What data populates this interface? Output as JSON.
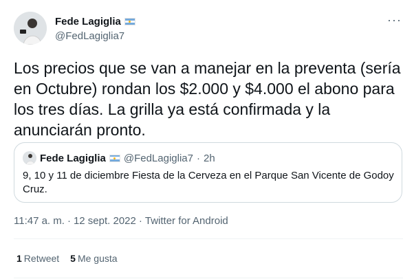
{
  "author": {
    "name": "Fede Lagiglia",
    "handle": "@FedLagiglia7"
  },
  "tweet": {
    "text": "Los precios que se van a manejar en la preventa (sería en Octubre) rondan los $2.000 y $4.000 el abono para los tres días. La grilla ya está confirmada y la anunciarán pronto."
  },
  "quoted": {
    "name": "Fede Lagiglia",
    "handle": "@FedLagiglia7",
    "separator": "·",
    "time": "2h",
    "text": "9, 10 y 11 de diciembre Fiesta de la Cerveza en el Parque San Vicente de Godoy Cruz."
  },
  "meta": {
    "time": "11:47 a. m.",
    "separator": "·",
    "date": "12 sept. 2022",
    "source": "Twitter for Android"
  },
  "stats": {
    "retweets_count": "1",
    "retweets_label": "Retweet",
    "likes_count": "5",
    "likes_label": "Me gusta"
  },
  "menu": {
    "more_label": "···"
  },
  "icons": {
    "flag": "argentina-flag-icon",
    "more": "more-options-icon"
  },
  "colors": {
    "flag_blue": "#75aadb",
    "flag_sun": "#f6b40e",
    "secondary": "#536471"
  }
}
